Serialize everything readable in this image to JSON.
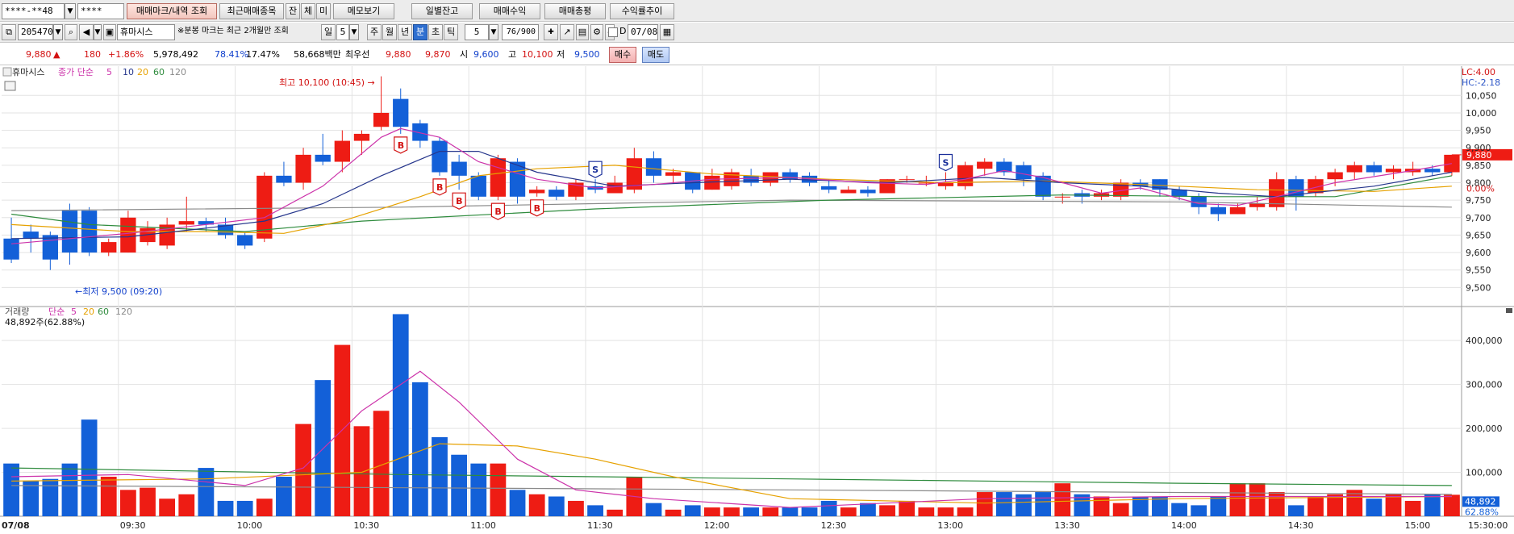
{
  "toolbar1": {
    "account_value": "****-**48",
    "password_value": "****",
    "buttons": [
      "매매마크/내역 조회",
      "최근매매종목",
      "잔",
      "체",
      "미",
      "메모보기"
    ],
    "right_buttons": [
      "일별잔고",
      "매매수익",
      "매매총평",
      "수익률추이"
    ]
  },
  "toolbar2": {
    "code_value": "205470",
    "stock_name": "휴마시스",
    "notice": "※분봉 마크는 최근 2개월만 조회",
    "period_tabs": [
      "일",
      "5",
      "주",
      "월",
      "년",
      "분",
      "초",
      "틱"
    ],
    "active_tab": "분",
    "interval_value": "5",
    "count_text": "76/900",
    "date_value": "07/08",
    "checkbox_label": "D"
  },
  "quote": {
    "price": "9,880",
    "arrow": "▲",
    "change": "180",
    "change_pct": "+1.86%",
    "volume": "5,978,492",
    "vol_ratio": "78.41%",
    "turnover": "17.47%",
    "amount": "58,668백만",
    "best_label": "최우선",
    "ask1": "9,880",
    "bid1": "9,870",
    "open_label": "시",
    "open": "9,600",
    "high_label": "고",
    "high": "10,100",
    "low_label": "저",
    "low": "9,500",
    "buy_label": "매수",
    "sell_label": "매도"
  },
  "colors": {
    "up": "#ee1c14",
    "down": "#1360d8",
    "ma5": "#cc33aa",
    "ma10": "#26368c",
    "ma20": "#e6a100",
    "ma60": "#2e8b3d",
    "ma120": "#8a8a8a",
    "grid": "#e3e3e3"
  },
  "chart_data": [
    {
      "type": "candlestick",
      "title": "휴마시스",
      "legend_prefix": "종가 단순",
      "ma_periods": [
        "5",
        "10",
        "20",
        "60",
        "120"
      ],
      "corner_labels": [
        "LC:4.00",
        "HC:-2.18"
      ],
      "annotations": {
        "high_text": "최고 10,100 (10:45) →",
        "low_text": "←최저 9,500 (09:20)"
      },
      "ylim": [
        9450,
        10120
      ],
      "y_ticks": [
        "9,500",
        "9,550",
        "9,600",
        "9,650",
        "9,700",
        "9,750",
        "9,800",
        "9,850",
        "9,900",
        "9,950",
        "10,000",
        "10,050"
      ],
      "current_price_label": "9,880",
      "zero_label": "0.00%",
      "x_labels": [
        "07/08",
        "09:30",
        "10:00",
        "10:30",
        "11:00",
        "11:30",
        "12:00",
        "12:30",
        "13:00",
        "13:30",
        "14:00",
        "14:30",
        "15:00",
        "15:30:00"
      ],
      "candles": [
        [
          9640,
          9580,
          9700,
          9570
        ],
        [
          9660,
          9640,
          9680,
          9600
        ],
        [
          9650,
          9580,
          9660,
          9550
        ],
        [
          9720,
          9600,
          9740,
          9570
        ],
        [
          9720,
          9600,
          9730,
          9590
        ],
        [
          9600,
          9630,
          9640,
          9590
        ],
        [
          9600,
          9700,
          9720,
          9600
        ],
        [
          9630,
          9670,
          9690,
          9620
        ],
        [
          9620,
          9680,
          9700,
          9610
        ],
        [
          9680,
          9690,
          9760,
          9660
        ],
        [
          9690,
          9680,
          9700,
          9660
        ],
        [
          9680,
          9650,
          9700,
          9640
        ],
        [
          9650,
          9620,
          9660,
          9610
        ],
        [
          9640,
          9820,
          9830,
          9630
        ],
        [
          9820,
          9800,
          9860,
          9790
        ],
        [
          9800,
          9880,
          9900,
          9780
        ],
        [
          9880,
          9860,
          9940,
          9850
        ],
        [
          9860,
          9920,
          9950,
          9830
        ],
        [
          9920,
          9940,
          9950,
          9880
        ],
        [
          9960,
          10000,
          10100,
          9950
        ],
        [
          10040,
          9960,
          10070,
          9940
        ],
        [
          9970,
          9920,
          9980,
          9900
        ],
        [
          9920,
          9830,
          9930,
          9820
        ],
        [
          9860,
          9820,
          9880,
          9780
        ],
        [
          9820,
          9760,
          9830,
          9750
        ],
        [
          9760,
          9870,
          9880,
          9750
        ],
        [
          9860,
          9760,
          9870,
          9740
        ],
        [
          9770,
          9780,
          9790,
          9760
        ],
        [
          9780,
          9760,
          9790,
          9750
        ],
        [
          9760,
          9800,
          9810,
          9750
        ],
        [
          9790,
          9780,
          9810,
          9770
        ],
        [
          9770,
          9800,
          9820,
          9770
        ],
        [
          9780,
          9870,
          9900,
          9770
        ],
        [
          9870,
          9820,
          9890,
          9800
        ],
        [
          9820,
          9830,
          9840,
          9800
        ],
        [
          9830,
          9780,
          9830,
          9770
        ],
        [
          9780,
          9820,
          9840,
          9780
        ],
        [
          9790,
          9830,
          9840,
          9780
        ],
        [
          9820,
          9800,
          9840,
          9790
        ],
        [
          9800,
          9830,
          9830,
          9790
        ],
        [
          9830,
          9810,
          9840,
          9800
        ],
        [
          9820,
          9800,
          9830,
          9790
        ],
        [
          9790,
          9780,
          9810,
          9770
        ],
        [
          9770,
          9780,
          9790,
          9770
        ],
        [
          9780,
          9770,
          9790,
          9760
        ],
        [
          9770,
          9810,
          9810,
          9770
        ],
        [
          9810,
          9810,
          9820,
          9800
        ],
        [
          9800,
          9800,
          9820,
          9790
        ],
        [
          9790,
          9800,
          9830,
          9780
        ],
        [
          9790,
          9850,
          9860,
          9780
        ],
        [
          9840,
          9860,
          9870,
          9820
        ],
        [
          9860,
          9830,
          9870,
          9820
        ],
        [
          9850,
          9810,
          9860,
          9790
        ],
        [
          9820,
          9760,
          9830,
          9750
        ],
        [
          9760,
          9760,
          9770,
          9740
        ],
        [
          9770,
          9760,
          9780,
          9740
        ],
        [
          9760,
          9770,
          9780,
          9750
        ],
        [
          9760,
          9800,
          9810,
          9750
        ],
        [
          9800,
          9790,
          9810,
          9780
        ],
        [
          9810,
          9780,
          9810,
          9760
        ],
        [
          9780,
          9760,
          9790,
          9750
        ],
        [
          9760,
          9730,
          9770,
          9710
        ],
        [
          9730,
          9710,
          9740,
          9690
        ],
        [
          9710,
          9730,
          9740,
          9710
        ],
        [
          9730,
          9740,
          9760,
          9720
        ],
        [
          9730,
          9810,
          9830,
          9720
        ],
        [
          9810,
          9760,
          9820,
          9720
        ],
        [
          9770,
          9810,
          9820,
          9760
        ],
        [
          9810,
          9830,
          9840,
          9790
        ],
        [
          9830,
          9850,
          9860,
          9810
        ],
        [
          9850,
          9830,
          9860,
          9820
        ],
        [
          9830,
          9840,
          9850,
          9810
        ],
        [
          9830,
          9840,
          9860,
          9820
        ],
        [
          9840,
          9830,
          9850,
          9820
        ],
        [
          9830,
          9880,
          9880,
          9820
        ]
      ],
      "ma5": [
        [
          0,
          9625
        ],
        [
          6,
          9655
        ],
        [
          10,
          9680
        ],
        [
          13,
          9700
        ],
        [
          16,
          9790
        ],
        [
          19,
          9930
        ],
        [
          20,
          9955
        ],
        [
          22,
          9930
        ],
        [
          24,
          9860
        ],
        [
          27,
          9810
        ],
        [
          30,
          9785
        ],
        [
          33,
          9795
        ],
        [
          36,
          9810
        ],
        [
          40,
          9815
        ],
        [
          44,
          9800
        ],
        [
          47,
          9795
        ],
        [
          49,
          9810
        ],
        [
          51,
          9835
        ],
        [
          53,
          9815
        ],
        [
          56,
          9770
        ],
        [
          58,
          9785
        ],
        [
          61,
          9740
        ],
        [
          63,
          9735
        ],
        [
          65,
          9760
        ],
        [
          68,
          9800
        ],
        [
          72,
          9835
        ],
        [
          74,
          9855
        ]
      ],
      "ma10": [
        [
          0,
          9640
        ],
        [
          6,
          9645
        ],
        [
          10,
          9670
        ],
        [
          13,
          9690
        ],
        [
          16,
          9740
        ],
        [
          19,
          9820
        ],
        [
          22,
          9890
        ],
        [
          24,
          9890
        ],
        [
          27,
          9830
        ],
        [
          31,
          9790
        ],
        [
          35,
          9800
        ],
        [
          40,
          9810
        ],
        [
          45,
          9800
        ],
        [
          50,
          9815
        ],
        [
          54,
          9800
        ],
        [
          58,
          9790
        ],
        [
          62,
          9770
        ],
        [
          65,
          9760
        ],
        [
          70,
          9790
        ],
        [
          74,
          9830
        ]
      ],
      "ma20": [
        [
          0,
          9680
        ],
        [
          6,
          9660
        ],
        [
          10,
          9660
        ],
        [
          14,
          9655
        ],
        [
          17,
          9690
        ],
        [
          21,
          9760
        ],
        [
          24,
          9820
        ],
        [
          27,
          9840
        ],
        [
          31,
          9850
        ],
        [
          36,
          9825
        ],
        [
          42,
          9810
        ],
        [
          48,
          9800
        ],
        [
          53,
          9805
        ],
        [
          58,
          9795
        ],
        [
          64,
          9780
        ],
        [
          70,
          9775
        ],
        [
          74,
          9790
        ]
      ],
      "ma60": [
        [
          0,
          9710
        ],
        [
          4,
          9680
        ],
        [
          12,
          9660
        ],
        [
          18,
          9690
        ],
        [
          30,
          9725
        ],
        [
          42,
          9750
        ],
        [
          54,
          9765
        ],
        [
          62,
          9760
        ],
        [
          68,
          9760
        ],
        [
          74,
          9820
        ]
      ],
      "ma120": [
        [
          0,
          9720
        ],
        [
          20,
          9730
        ],
        [
          40,
          9750
        ],
        [
          60,
          9745
        ],
        [
          74,
          9730
        ]
      ],
      "signals": [
        [
          20,
          "B"
        ],
        [
          22,
          "B"
        ],
        [
          23,
          "B"
        ],
        [
          25,
          "B"
        ],
        [
          27,
          "B"
        ],
        [
          30,
          "S"
        ],
        [
          48,
          "S"
        ]
      ]
    },
    {
      "type": "bar",
      "title": "거래량",
      "legend_prefix": "단순",
      "ma_periods": [
        "5",
        "20",
        "60",
        "120"
      ],
      "info_text": "48,892주(62.88%)",
      "ylim": [
        0,
        470000
      ],
      "y_ticks": [
        "100,000",
        "200,000",
        "300,000",
        "400,000"
      ],
      "current_volume_label": "48,892",
      "current_ratio_label": "62.88%",
      "volumes": [
        120000,
        80000,
        85000,
        120000,
        220000,
        90000,
        60000,
        65000,
        40000,
        50000,
        110000,
        35000,
        35000,
        40000,
        90000,
        210000,
        310000,
        390000,
        205000,
        240000,
        460000,
        305000,
        180000,
        140000,
        120000,
        120000,
        60000,
        50000,
        45000,
        35000,
        25000,
        15000,
        90000,
        30000,
        15000,
        25000,
        20000,
        20000,
        20000,
        20000,
        20000,
        20000,
        35000,
        20000,
        30000,
        25000,
        35000,
        20000,
        20000,
        20000,
        55000,
        55000,
        50000,
        55000,
        75000,
        50000,
        45000,
        30000,
        45000,
        45000,
        30000,
        25000,
        45000,
        75000,
        75000,
        55000,
        25000,
        45000,
        50000,
        60000,
        40000,
        50000,
        35000,
        50000,
        48892
      ],
      "vma5": [
        [
          0,
          90000
        ],
        [
          6,
          95000
        ],
        [
          12,
          70000
        ],
        [
          15,
          110000
        ],
        [
          18,
          240000
        ],
        [
          21,
          330000
        ],
        [
          23,
          260000
        ],
        [
          26,
          130000
        ],
        [
          29,
          60000
        ],
        [
          33,
          40000
        ],
        [
          40,
          20000
        ],
        [
          50,
          40000
        ],
        [
          60,
          45000
        ],
        [
          70,
          45000
        ],
        [
          74,
          45000
        ]
      ],
      "vma20": [
        [
          0,
          80000
        ],
        [
          10,
          85000
        ],
        [
          18,
          100000
        ],
        [
          22,
          165000
        ],
        [
          26,
          160000
        ],
        [
          30,
          130000
        ],
        [
          34,
          90000
        ],
        [
          40,
          40000
        ],
        [
          50,
          30000
        ],
        [
          60,
          40000
        ],
        [
          74,
          45000
        ]
      ],
      "vma60": [
        [
          0,
          110000
        ],
        [
          20,
          95000
        ],
        [
          40,
          85000
        ],
        [
          60,
          75000
        ],
        [
          74,
          70000
        ]
      ],
      "vma120": [
        [
          0,
          70000
        ],
        [
          40,
          60000
        ],
        [
          74,
          50000
        ]
      ]
    }
  ]
}
